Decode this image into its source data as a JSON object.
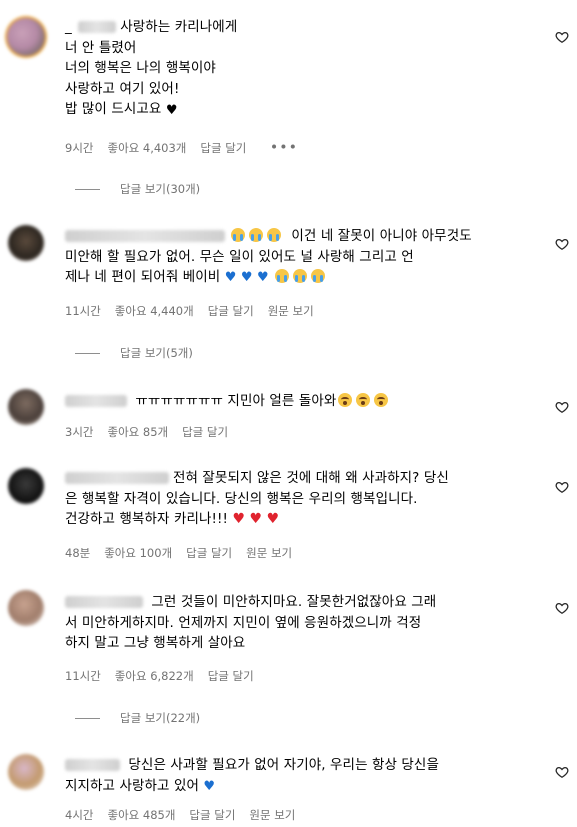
{
  "comments": [
    {
      "lines": [
        "사랑하는 카리나에게",
        "너 안 틀렸어",
        "너의 행복은 나의 행복이야",
        "사랑하고 여기 있어!",
        "밥 많이 드시고요"
      ],
      "prefix": "_",
      "time": "9시간",
      "likes": "좋아요 4,403개",
      "reply": "답글 달기",
      "more": "•••",
      "replies": "답글 보기(30개)"
    },
    {
      "lines": [
        "이건 네 잘못이 아니야 아무것도",
        "미안해 할 필요가 없어. 무슨 일이 있어도 널 사랑해 그리고 언",
        "제나 네 편이 되어줘 베이비"
      ],
      "time": "11시간",
      "likes": "좋아요 4,440개",
      "reply": "답글 달기",
      "translate": "원문 보기",
      "replies": "답글 보기(5개)"
    },
    {
      "lines": [
        "ㅠㅠㅠㅠㅠㅠㅠ 지민아 얼른 돌아와"
      ],
      "time": "3시간",
      "likes": "좋아요 85개",
      "reply": "답글 달기"
    },
    {
      "lines": [
        "전혀 잘못되지 않은 것에 대해 왜 사과하지? 당신",
        "은 행복할 자격이 있습니다. 당신의 행복은 우리의 행복입니다.",
        "건강하고 행복하자 카리나!!!"
      ],
      "time": "48분",
      "likes": "좋아요 100개",
      "reply": "답글 달기",
      "translate": "원문 보기"
    },
    {
      "lines": [
        "그런 것들이 미안하지마요. 잘못한거없잖아요 그래",
        "서 미안하게하지마. 언제까지 지민이 옆에 응원하겠으니까 걱정",
        "하지 말고 그냥 행복하게 살아요"
      ],
      "time": "11시간",
      "likes": "좋아요 6,822개",
      "reply": "답글 달기",
      "replies": "답글 보기(22개)"
    },
    {
      "lines": [
        "당신은 사과할 필요가 없어 자기야, 우리는 항상 당신을",
        "지지하고 사랑하고 있어"
      ],
      "time": "4시간",
      "likes": "좋아요 485개",
      "reply": "답글 달기",
      "translate": "원문 보기"
    }
  ],
  "icons": {
    "like": "heart-outline-icon",
    "more": "more-dots-icon"
  },
  "colors": {
    "meta": "#737373",
    "blue_heart": "#1b6fd0",
    "red_heart": "#e0232e",
    "story_ring": "#e9a43a"
  }
}
